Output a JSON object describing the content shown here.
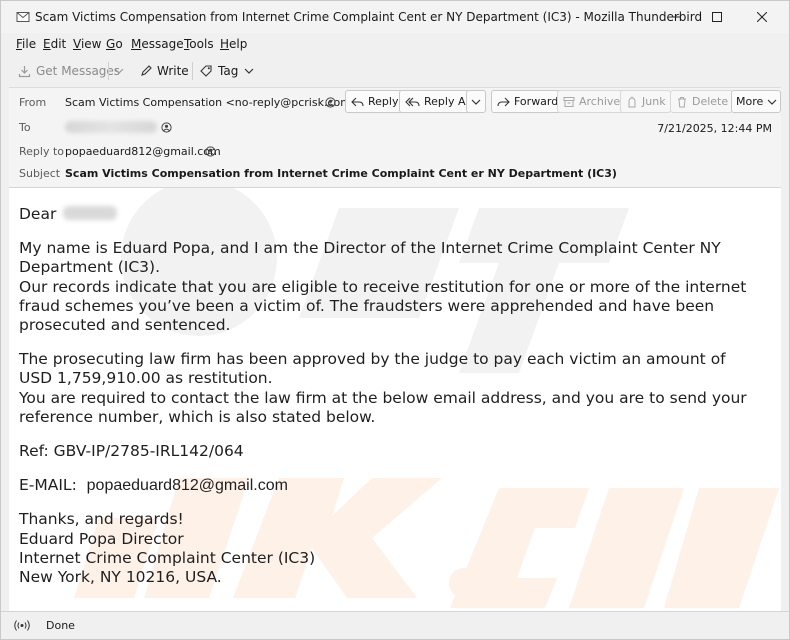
{
  "window": {
    "title": "Scam Victims Compensation from Internet Crime Complaint Cent er NY Department (IC3) - Mozilla Thunderbird"
  },
  "menu": {
    "items": [
      {
        "accel": "F",
        "rest": "ile"
      },
      {
        "accel": "E",
        "rest": "dit"
      },
      {
        "accel": "V",
        "rest": "iew"
      },
      {
        "accel": "G",
        "rest": "o"
      },
      {
        "accel": "M",
        "rest": "essage"
      },
      {
        "accel": "T",
        "rest": "ools"
      },
      {
        "accel": "H",
        "rest": "elp"
      }
    ]
  },
  "toolbar": {
    "get_messages": "Get Messages",
    "write": "Write",
    "tag": "Tag"
  },
  "header": {
    "from_label": "From",
    "from_value": "Scam Victims Compensation <no-reply@pcrisk.com>",
    "to_label": "To",
    "reply_to_label": "Reply to",
    "reply_to_value": "popaeduard812@gmail.com",
    "subject_label": "Subject",
    "subject_value": "Scam Victims Compensation from Internet Crime Complaint Cent er NY Department (IC3)",
    "date": "7/21/2025, 12:44 PM",
    "actions": {
      "reply": "Reply",
      "reply_all": "Reply All",
      "forward": "Forward",
      "archive": "Archive",
      "junk": "Junk",
      "delete": "Delete",
      "more": "More"
    }
  },
  "message": {
    "greeting": "Dear",
    "p1_l1": "My name is Eduard Popa, and I am the Director of the Internet Crime Complaint Center NY",
    "p1_l2": "Department (IC3).",
    "p1_l3": "Our records indicate that you are eligible to receive restitution for one or more of the internet",
    "p1_l4": "fraud schemes you’ve been a victim of. The fraudsters were apprehended and have been",
    "p1_l5": "prosecuted and sentenced.",
    "p2_l1": "The prosecuting law firm has been approved by the judge to pay each victim an amount of",
    "p2_l2": "USD 1,759,910.00 as restitution.",
    "p2_l3": "You are required to contact the law firm at the below email address, and you are to send your",
    "p2_l4": "reference number, which is also stated below.",
    "ref": "Ref: GBV-IP/2785-IRL142/064",
    "email_label": "E-MAIL:",
    "email_value": "popaeduard812@gmail.com",
    "sig_l1": "Thanks, and regards!",
    "sig_l2": "Eduard Popa Director",
    "sig_l3": "Internet Crime Complaint Center (IC3)",
    "sig_l4": "New York, NY 10216, USA."
  },
  "status": {
    "text": "Done"
  }
}
